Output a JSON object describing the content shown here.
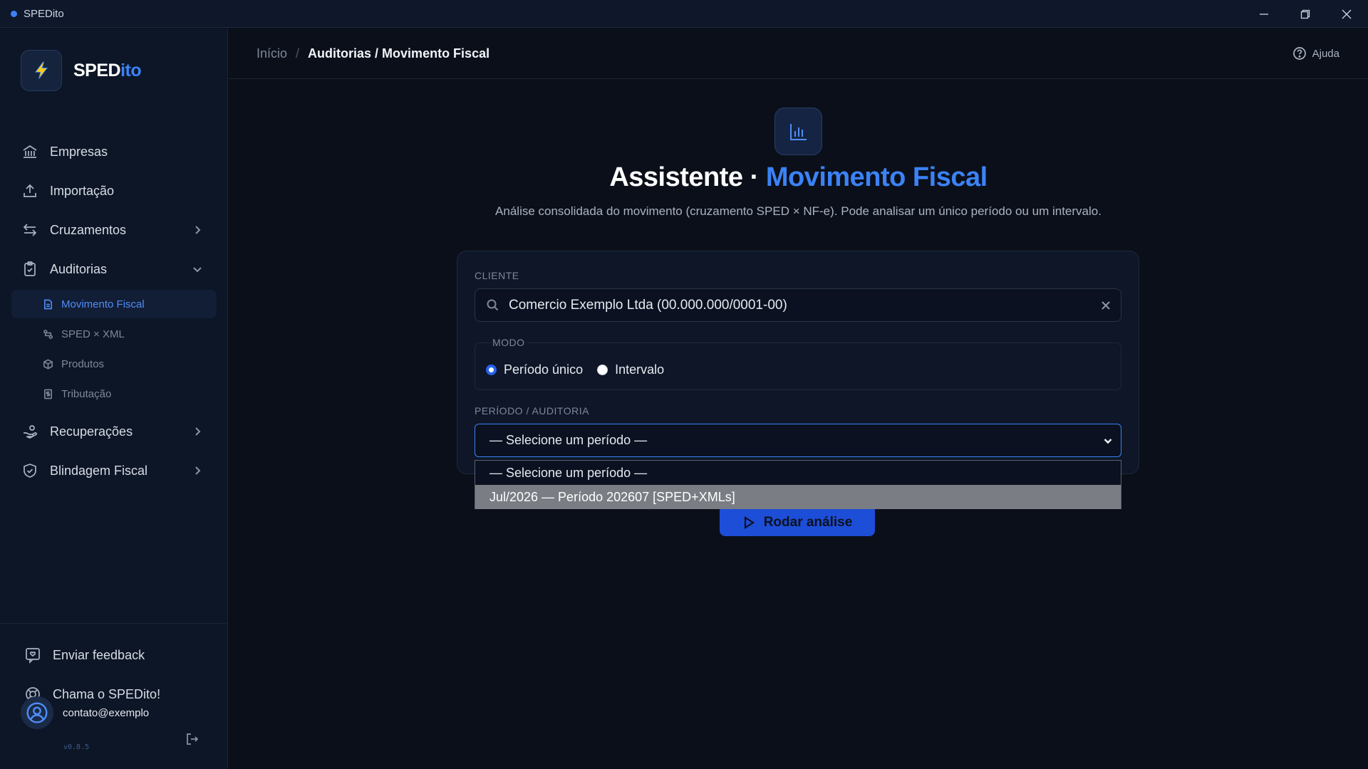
{
  "window": {
    "title": "SPEDito"
  },
  "sidebar": {
    "logo_main": "SPED",
    "logo_accent": "ito",
    "items": [
      {
        "label": "Empresas"
      },
      {
        "label": "Importação"
      },
      {
        "label": "Cruzamentos"
      },
      {
        "label": "Auditorias"
      },
      {
        "label": "Recuperações"
      },
      {
        "label": "Blindagem Fiscal"
      }
    ],
    "sub_items": [
      {
        "label": "Movimento Fiscal"
      },
      {
        "label": "SPED × XML"
      },
      {
        "label": "Produtos"
      },
      {
        "label": "Tributação"
      }
    ],
    "feedback": "Enviar feedback",
    "support": "Chama o SPEDito!",
    "user_email": "contato@exemplo",
    "version": "v0.8.5"
  },
  "header": {
    "crumb_home": "Início",
    "crumb_sep": "/",
    "crumb_current": "Auditorias / Movimento Fiscal",
    "help": "Ajuda"
  },
  "main": {
    "title_prefix": "Assistente · ",
    "title_accent": "Movimento Fiscal",
    "subtitle": "Análise consolidada do movimento (cruzamento SPED × NF-e). Pode analisar um único período ou um intervalo.",
    "cliente_label": "CLIENTE",
    "cliente_value": "Comercio Exemplo Ltda (00.000.000/0001-00)",
    "modo_label": "MODO",
    "modo_option_1": "Período único",
    "modo_option_2": "Intervalo",
    "periodo_label": "PERÍODO / AUDITORIA",
    "periodo_selected": "— Selecione um período —",
    "periodo_options": [
      "— Selecione um período —",
      "Jul/2026 — Período 202607 [SPED+XMLs]"
    ],
    "run_button": "Rodar análise"
  },
  "colors": {
    "accent": "#3b82f6",
    "background": "#0b0f19",
    "sidebar": "#0d1627"
  }
}
